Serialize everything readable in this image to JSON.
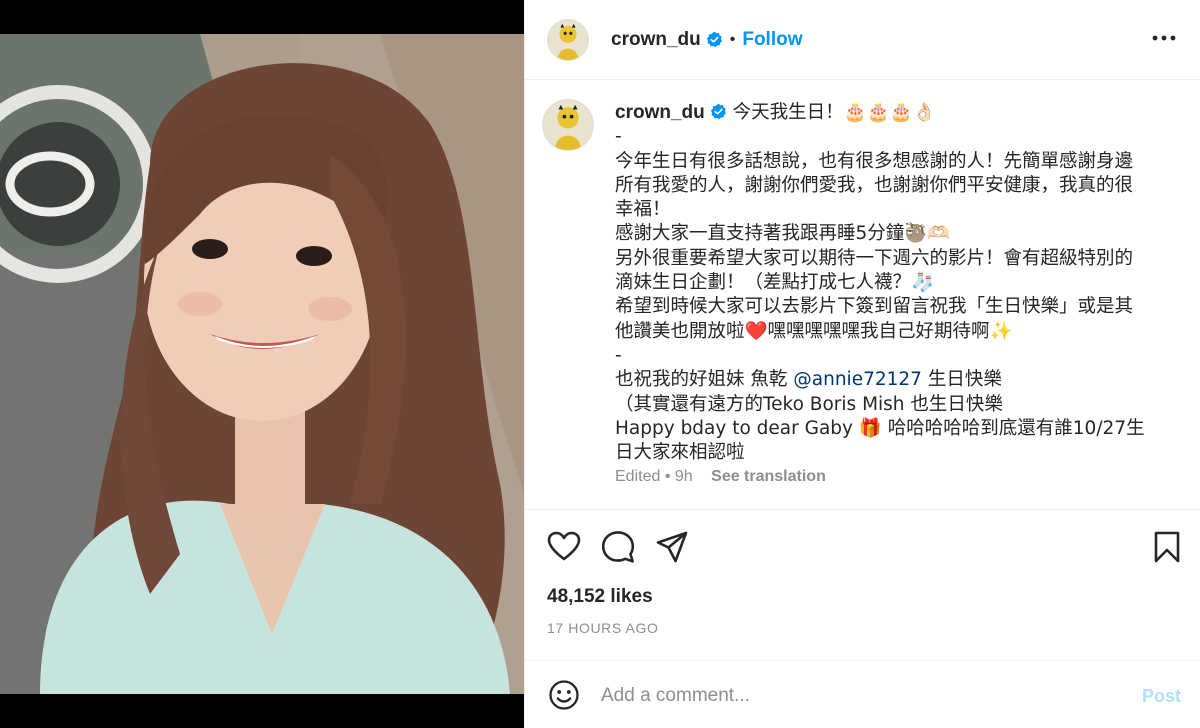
{
  "post": {
    "username": "crown_du",
    "follow_label": "Follow",
    "separator": "•",
    "caption_lines": [
      "今天我生日！🎂🎂🎂👌🏻",
      "-",
      "今年生日有很多話想說，也有很多想感謝的人！先簡單感謝身邊",
      "所有我愛的人，謝謝你們愛我，也謝謝你們平安健康，我真的很",
      "幸福！",
      "感謝大家一直支持著我跟再睡5分鐘🦥🫶🏻",
      "另外很重要希望大家可以期待一下週六的影片！會有超級特別的",
      "滴妹生日企劃！（差點打成七人襪？🧦",
      "希望到時候大家可以去影片下簽到留言祝我「生日快樂」或是其",
      "他讚美也開放啦❤️嘿嘿嘿嘿嘿我自己好期待啊✨",
      "-"
    ],
    "caption_mention_line": {
      "before": "也祝我的好姐妹 魚乾 ",
      "mention": "@annie72127",
      "after": " 生日快樂"
    },
    "caption_tail_lines": [
      "（其實還有遠方的Teko Boris Mish 也生日快樂",
      "Happy bday to dear Gaby 🎁 哈哈哈哈哈到底還有誰10/27生",
      "日大家來相認啦"
    ],
    "edited_label": "Edited",
    "edited_age": "9h",
    "see_translation": "See translation",
    "likes": "48,152 likes",
    "timestamp": "17 HOURS AGO",
    "comment_placeholder": "Add a comment...",
    "post_label": "Post"
  },
  "icons": {
    "verified": "verified-badge-icon",
    "more": "more-options-icon",
    "like": "heart-icon",
    "comment": "comment-bubble-icon",
    "share": "paper-plane-icon",
    "save": "bookmark-icon",
    "emoji": "smiley-icon"
  },
  "colors": {
    "accent": "#0095f6",
    "verified": "#0095f6",
    "mention": "#00376b",
    "muted": "#8e8e8e",
    "post_disabled": "#b2dffc",
    "media_bg": "#000000"
  }
}
